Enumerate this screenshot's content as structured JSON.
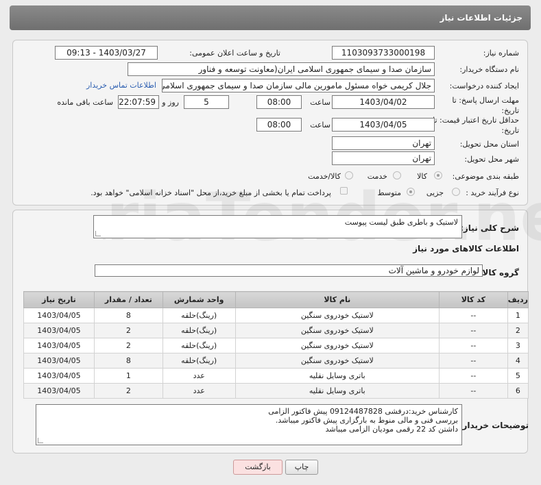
{
  "header": {
    "title": "جزئیات اطلاعات نیاز"
  },
  "form": {
    "need_number_label": "شماره نیاز:",
    "need_number": "1103093733000198",
    "announce_datetime_label": "تاریخ و ساعت اعلان عمومی:",
    "announce_datetime": "1403/03/27 - 09:13",
    "buyer_org_label": "نام دستگاه خریدار:",
    "buyer_org": "سازمان صدا و سیمای جمهوری اسلامی ایران(معاونت توسعه و فناور",
    "creator_label": "ایجاد کننده درخواست:",
    "creator": "جلال کریمی خواه مسئول مامورین مالی  سازمان صدا و سیمای جمهوری اسلامی ا",
    "buyer_contact_link": "اطلاعات تماس خریدار",
    "reply_deadline_label": "مهلت ارسال پاسخ: تا تاریخ:",
    "reply_date": "1403/04/02",
    "time_label": "ساعت",
    "reply_time": "08:00",
    "days_value": "5",
    "days_label": "روز و",
    "remaining_time": "22:07:59",
    "remaining_label": "ساعت باقی مانده",
    "price_validity_label": "حداقل تاریخ اعتبار قیمت: تا تاریخ:",
    "price_validity_date": "1403/04/05",
    "price_validity_time": "08:00",
    "delivery_province_label": "استان محل تحویل:",
    "delivery_province": "تهران",
    "delivery_city_label": "شهر محل تحویل:",
    "delivery_city": "تهران",
    "category_label": "طبقه بندی موضوعی:",
    "category_options": [
      "کالا",
      "خدمت",
      "کالا/خدمت"
    ],
    "process_label": "نوع فرآیند خرید :",
    "process_options": [
      "جزیی",
      "متوسط"
    ],
    "payment_note": "پرداخت تمام یا بخشی از مبلغ خرید،از محل \"اسناد خزانه اسلامی\" خواهد بود."
  },
  "details": {
    "description_label": "شرح کلی نیاز:",
    "description": "لاستیک و باطری طبق لیست پیوست",
    "goods_info_title": "اطلاعات کالاهای مورد نیاز",
    "goods_group_label": "گروه کالا:",
    "goods_group": "لوازم خودرو و ماشین آلات"
  },
  "table": {
    "headers": [
      "ردیف",
      "کد کالا",
      "نام کالا",
      "واحد شمارش",
      "تعداد / مقدار",
      "تاریخ نیاز"
    ],
    "rows": [
      [
        "1",
        "--",
        "لاستیک خودروی سنگین",
        "(رینگ)حلقه",
        "8",
        "1403/04/05"
      ],
      [
        "2",
        "--",
        "لاستیک خودروی سنگین",
        "(رینگ)حلقه",
        "2",
        "1403/04/05"
      ],
      [
        "3",
        "--",
        "لاستیک خودروی سنگین",
        "(رینگ)حلقه",
        "2",
        "1403/04/05"
      ],
      [
        "4",
        "--",
        "لاستیک خودروی سنگین",
        "(رینگ)حلقه",
        "8",
        "1403/04/05"
      ],
      [
        "5",
        "--",
        "باتری وسایل نقلیه",
        "عدد",
        "1",
        "1403/04/05"
      ],
      [
        "6",
        "--",
        "باتری وسایل نقلیه",
        "عدد",
        "2",
        "1403/04/05"
      ]
    ]
  },
  "notes": {
    "label": "توضیحات خریدار:",
    "lines": [
      "کارشناس خرید:درفشی  09124487828  پیش فاکتور الزامی",
      "بررسی فنی و مالی منوط به بارگزاری پیش فاکتور میباشد.",
      "داشتن کد 22 رقمی مودیان الزامی میباشد"
    ]
  },
  "buttons": {
    "print": "چاپ",
    "back": "بازگشت"
  },
  "watermark": {
    "text": "AriaTender.net"
  }
}
